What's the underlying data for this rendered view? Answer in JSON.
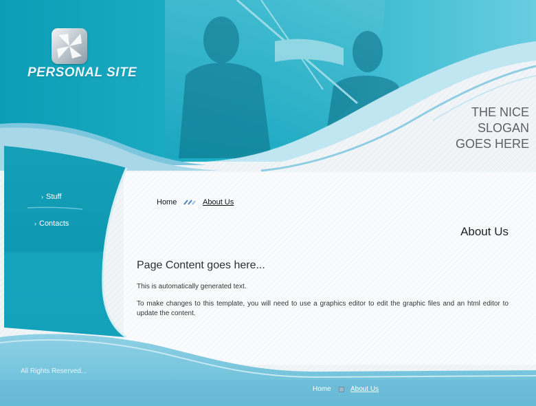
{
  "header": {
    "site_name": "PERSONAL SITE",
    "slogan": [
      "THE NICE",
      "SLOGAN",
      "GOES HERE"
    ],
    "logo_icon": "pinwheel-icon"
  },
  "sidebar": {
    "items": [
      {
        "label": "Stuff",
        "icon": "chevron-right-icon"
      },
      {
        "label": "Contacts",
        "icon": "chevron-right-icon"
      }
    ]
  },
  "breadcrumb": {
    "home": "Home",
    "current": "About Us",
    "separator_icon": "double-slash-icon"
  },
  "main": {
    "page_heading": "About Us",
    "content_title": "Page Content goes here...",
    "paragraphs": [
      "This is automatically generated text.",
      "To make changes to this template, you will need to use a graphics editor to edit the graphic files and an html editor to update the content."
    ]
  },
  "footer": {
    "copyright": "All Rights Reserved...",
    "links": [
      {
        "label": "Home"
      },
      {
        "label": "About Us"
      }
    ]
  },
  "colors": {
    "teal_dark": "#0f97b0",
    "teal_light": "#62c9de",
    "sky": "#7fc3dc",
    "text": "#333333"
  }
}
